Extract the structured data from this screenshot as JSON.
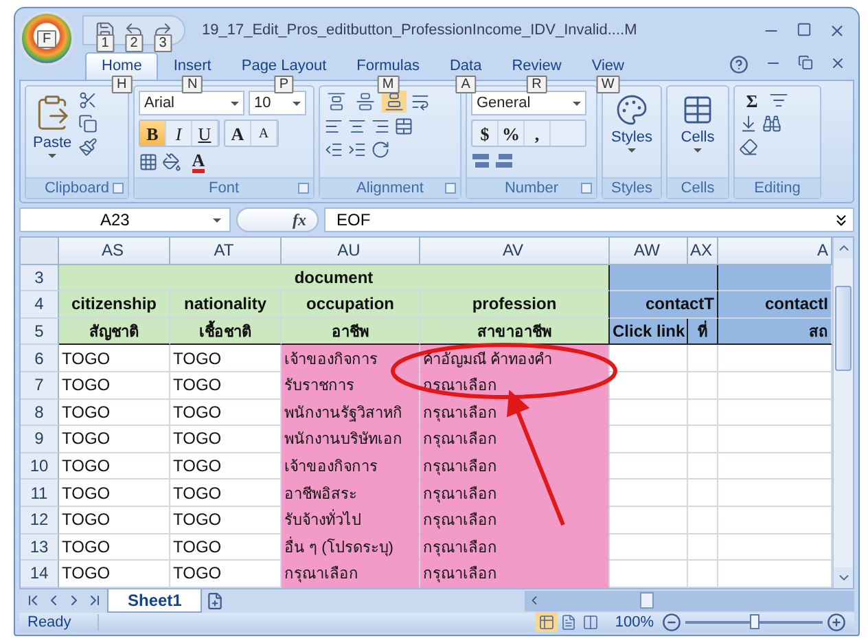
{
  "window": {
    "title": "19_17_Edit_Pros_editbutton_ProfessionIncome_IDV_Invalid....M",
    "office_keytip": "F"
  },
  "quick_access": [
    {
      "kind": "save",
      "keytip": "1"
    },
    {
      "kind": "undo",
      "keytip": "2"
    },
    {
      "kind": "redo",
      "keytip": "3"
    }
  ],
  "tabs": [
    {
      "label": "Home",
      "keytip": "H",
      "selected": true
    },
    {
      "label": "Insert",
      "keytip": "N",
      "selected": false
    },
    {
      "label": "Page Layout",
      "keytip": "P",
      "selected": false
    },
    {
      "label": "Formulas",
      "keytip": "M",
      "selected": false
    },
    {
      "label": "Data",
      "keytip": "A",
      "selected": false
    },
    {
      "label": "Review",
      "keytip": "R",
      "selected": false
    },
    {
      "label": "View",
      "keytip": "W",
      "selected": false
    }
  ],
  "ribbon": {
    "groups": [
      {
        "label": "Clipboard",
        "kind": "clipboard",
        "launcher": true
      },
      {
        "label": "Font",
        "kind": "font",
        "launcher": true
      },
      {
        "label": "Alignment",
        "kind": "alignment",
        "launcher": true
      },
      {
        "label": "Number",
        "kind": "number",
        "launcher": true
      },
      {
        "label": "Styles",
        "kind": "styles",
        "launcher": false
      },
      {
        "label": "Cells",
        "kind": "cells",
        "launcher": false
      },
      {
        "label": "Editing",
        "kind": "editing",
        "launcher": false
      }
    ],
    "paste": "Paste",
    "font_name": "Arial",
    "font_size": "10",
    "font_buttons": [
      {
        "label": "B",
        "selected": true
      },
      {
        "label": "I",
        "selected": false
      },
      {
        "label": "U",
        "selected": false
      }
    ],
    "grow": "A",
    "shrink": "A",
    "font_color": "A",
    "align_buttons": [
      {
        "kind": "top",
        "selected": false
      },
      {
        "kind": "middle",
        "selected": false
      },
      {
        "kind": "bottom",
        "selected": true
      }
    ],
    "number_format": "General",
    "number_buttons": [
      "$",
      "%",
      ","
    ],
    "styles": "Styles",
    "cells": "Cells",
    "sum": "Σ"
  },
  "formula_bar": {
    "name_box": "A23",
    "fx": "fx",
    "formula": "EOF"
  },
  "columns": [
    "AS",
    "AT",
    "AU",
    "AV",
    "AW",
    "AX",
    "A"
  ],
  "rows": [
    {
      "number": "3",
      "kind": "band",
      "text": "document"
    },
    {
      "number": "4",
      "kind": "header",
      "cells": [
        "citizenship",
        "nationality",
        "occupation",
        "profession",
        "contactT",
        "contactI"
      ]
    },
    {
      "number": "5",
      "kind": "subheader",
      "cells": [
        "สัญชาติ",
        "เชื้อชาติ",
        "อาชีพ",
        "สาขาอาชีพ",
        "Click link",
        "ที่",
        "สถ"
      ]
    },
    {
      "number": "6",
      "kind": "data",
      "cells": [
        "TOGO",
        "TOGO",
        "เจ้าของกิจการ",
        "ค้าอัญมณี  ค้าทองคำ"
      ]
    },
    {
      "number": "7",
      "kind": "data",
      "cells": [
        "TOGO",
        "TOGO",
        "รับราชการ",
        "กรุณาเลือก"
      ]
    },
    {
      "number": "8",
      "kind": "data",
      "cells": [
        "TOGO",
        "TOGO",
        "พนักงานรัฐวิสาหกิ",
        "กรุณาเลือก"
      ]
    },
    {
      "number": "9",
      "kind": "data",
      "cells": [
        "TOGO",
        "TOGO",
        "พนักงานบริษัทเอก",
        "กรุณาเลือก"
      ]
    },
    {
      "number": "10",
      "kind": "data",
      "cells": [
        "TOGO",
        "TOGO",
        "เจ้าของกิจการ",
        "กรุณาเลือก"
      ]
    },
    {
      "number": "11",
      "kind": "data",
      "cells": [
        "TOGO",
        "TOGO",
        "อาชีพอิสระ",
        "กรุณาเลือก"
      ]
    },
    {
      "number": "12",
      "kind": "data",
      "cells": [
        "TOGO",
        "TOGO",
        "รับจ้างทั่วไป",
        "กรุณาเลือก"
      ]
    },
    {
      "number": "13",
      "kind": "data",
      "cells": [
        "TOGO",
        "TOGO",
        "อื่น ๆ (โปรดระบุ)",
        "กรุณาเลือก"
      ]
    },
    {
      "number": "14",
      "kind": "data",
      "cells": [
        "TOGO",
        "TOGO",
        "กรุณาเลือก",
        "กรุณาเลือก"
      ]
    }
  ],
  "sheet_tabs": [
    {
      "label": "Sheet1",
      "selected": true
    }
  ],
  "status_bar": {
    "status": "Ready",
    "views": [
      {
        "kind": "normal",
        "selected": true
      },
      {
        "kind": "page_layout",
        "selected": false
      },
      {
        "kind": "page_break",
        "selected": false
      }
    ],
    "zoom": "100%",
    "level": 0.5
  }
}
